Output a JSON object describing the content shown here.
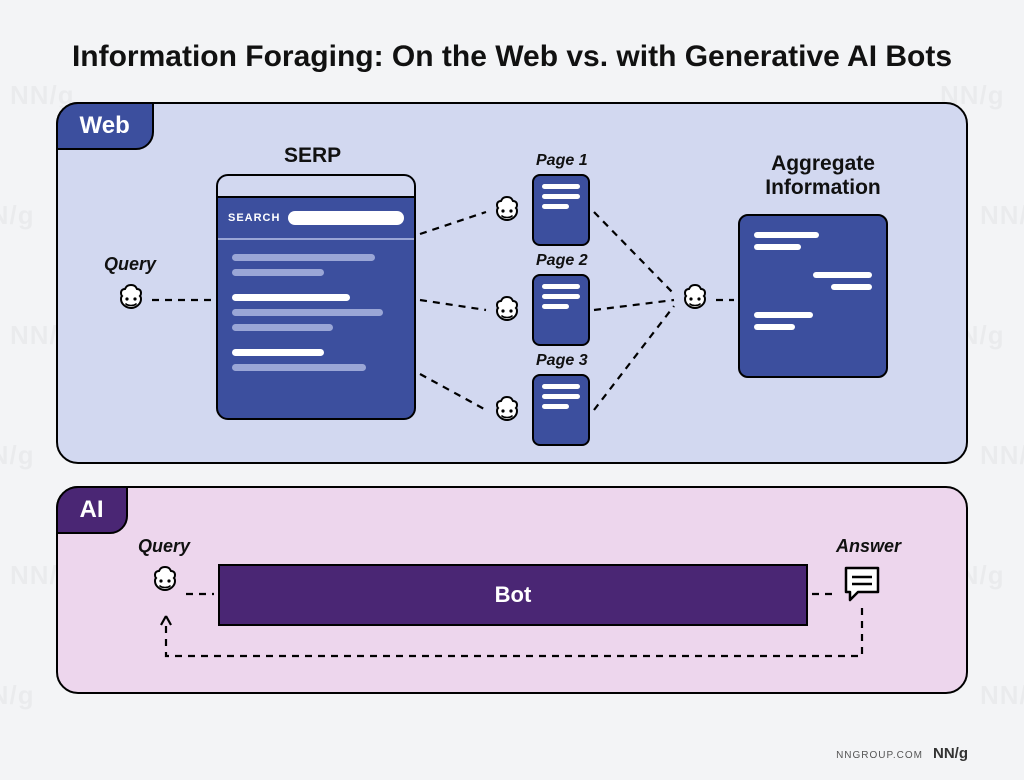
{
  "title": "Information Foraging: On the Web vs. with Generative AI Bots",
  "watermark": "NN/g",
  "web": {
    "tab": "Web",
    "query_label": "Query",
    "serp_label": "SERP",
    "search_text": "SEARCH",
    "pages": [
      "Page 1",
      "Page 2",
      "Page 3"
    ],
    "aggregate_label": "Aggregate\nInformation"
  },
  "ai": {
    "tab": "AI",
    "query_label": "Query",
    "bot_label": "Bot",
    "answer_label": "Answer"
  },
  "attribution": {
    "site": "NNGROUP.COM",
    "logo": "NN/g"
  }
}
